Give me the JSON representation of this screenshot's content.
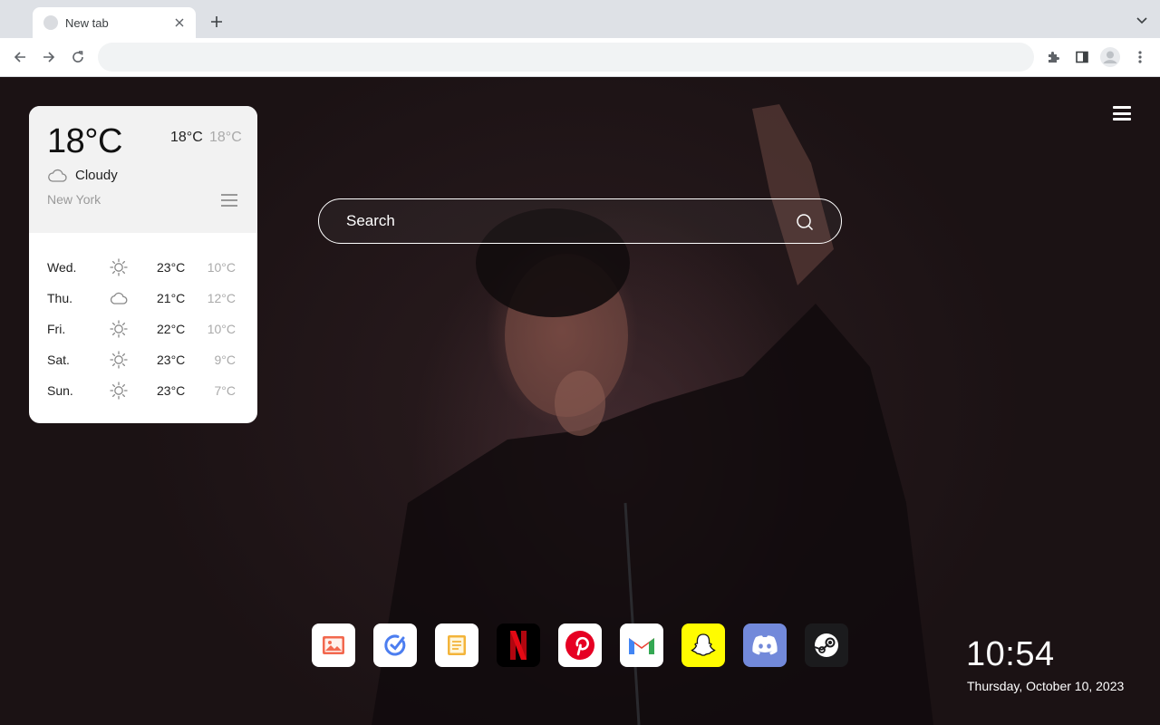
{
  "browser": {
    "tab_title": "New tab",
    "omnibox_value": ""
  },
  "weather": {
    "current_temp": "18°C",
    "high": "18°C",
    "low": "18°C",
    "condition": "Cloudy",
    "city": "New York",
    "forecast": [
      {
        "day": "Wed.",
        "icon": "sun-icon",
        "high": "23°C",
        "low": "10°C"
      },
      {
        "day": "Thu.",
        "icon": "cloud-icon",
        "high": "21°C",
        "low": "12°C"
      },
      {
        "day": "Fri.",
        "icon": "sun-icon",
        "high": "22°C",
        "low": "10°C"
      },
      {
        "day": "Sat.",
        "icon": "sun-icon",
        "high": "23°C",
        "low": "9°C"
      },
      {
        "day": "Sun.",
        "icon": "sun-icon",
        "high": "23°C",
        "low": "7°C"
      }
    ]
  },
  "search": {
    "placeholder": "Search"
  },
  "dock": [
    {
      "name": "photos-app",
      "icon": "image-icon",
      "color": "#f2684e"
    },
    {
      "name": "tasks-app",
      "icon": "check-circle-icon",
      "color": "#4c7ef0"
    },
    {
      "name": "notes-app",
      "icon": "note-icon",
      "color": "#f3b43a"
    },
    {
      "name": "netflix-app",
      "icon": "netflix-icon",
      "color": "#e50914"
    },
    {
      "name": "pinterest-app",
      "icon": "pinterest-icon",
      "color": "#e60023"
    },
    {
      "name": "gmail-app",
      "icon": "gmail-icon",
      "color": "#ea4335"
    },
    {
      "name": "snapchat-app",
      "icon": "snapchat-icon",
      "color": "#fffc00"
    },
    {
      "name": "discord-app",
      "icon": "discord-icon",
      "color": "#5865f2"
    },
    {
      "name": "steam-app",
      "icon": "steam-icon",
      "color": "#1b1b1d"
    }
  ],
  "clock": {
    "time": "10:54",
    "date": "Thursday, October 10, 2023"
  }
}
